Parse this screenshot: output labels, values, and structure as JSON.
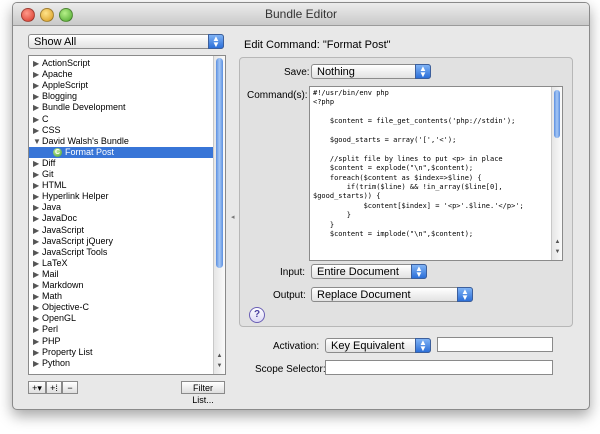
{
  "window": {
    "title": "Bundle Editor"
  },
  "filter": {
    "selected": "Show All"
  },
  "bundle_list": {
    "items": [
      {
        "label": "ActionScript",
        "expanded": false
      },
      {
        "label": "Apache",
        "expanded": false
      },
      {
        "label": "AppleScript",
        "expanded": false
      },
      {
        "label": "Blogging",
        "expanded": false
      },
      {
        "label": "Bundle Development",
        "expanded": false
      },
      {
        "label": "C",
        "expanded": false
      },
      {
        "label": "CSS",
        "expanded": false
      },
      {
        "label": "David Walsh's Bundle",
        "expanded": true
      },
      {
        "label": "Format Post",
        "child": true,
        "selected": true
      },
      {
        "label": "Diff",
        "expanded": false
      },
      {
        "label": "Git",
        "expanded": false
      },
      {
        "label": "HTML",
        "expanded": false
      },
      {
        "label": "Hyperlink Helper",
        "expanded": false
      },
      {
        "label": "Java",
        "expanded": false
      },
      {
        "label": "JavaDoc",
        "expanded": false
      },
      {
        "label": "JavaScript",
        "expanded": false
      },
      {
        "label": "JavaScript jQuery",
        "expanded": false
      },
      {
        "label": "JavaScript Tools",
        "expanded": false
      },
      {
        "label": "LaTeX",
        "expanded": false
      },
      {
        "label": "Mail",
        "expanded": false
      },
      {
        "label": "Markdown",
        "expanded": false
      },
      {
        "label": "Math",
        "expanded": false
      },
      {
        "label": "Objective-C",
        "expanded": false
      },
      {
        "label": "OpenGL",
        "expanded": false
      },
      {
        "label": "Perl",
        "expanded": false
      },
      {
        "label": "PHP",
        "expanded": false
      },
      {
        "label": "Property List",
        "expanded": false
      },
      {
        "label": "Python",
        "expanded": false
      }
    ]
  },
  "bottom_bar": {
    "add_label": "+▾",
    "add_folder_label": "+⁞",
    "remove_label": "−",
    "filter_list_label": "Filter List..."
  },
  "editor": {
    "heading": "Edit Command: \"Format Post\"",
    "save_label": "Save:",
    "save_value": "Nothing",
    "command_label": "Command(s):",
    "code": "#!/usr/bin/env php\n<?php\n\n    $content = file_get_contents('php://stdin');\n\n    $good_starts = array('[','<');\n\n    //split file by lines to put <p> in place\n    $content = explode(\"\\n\",$content);\n    foreach($content as $index=>$line) {\n        if(trim($line) && !in_array($line[0],\n$good_starts)) {\n            $content[$index] = '<p>'.$line.'</p>';\n        }\n    }\n    $content = implode(\"\\n\",$content);",
    "input_label": "Input:",
    "input_value": "Entire Document",
    "output_label": "Output:",
    "output_value": "Replace Document",
    "help_label": "?",
    "activation_label": "Activation:",
    "activation_value": "Key Equivalent",
    "activation_key": "",
    "scope_label": "Scope Selector:",
    "scope_value": ""
  }
}
